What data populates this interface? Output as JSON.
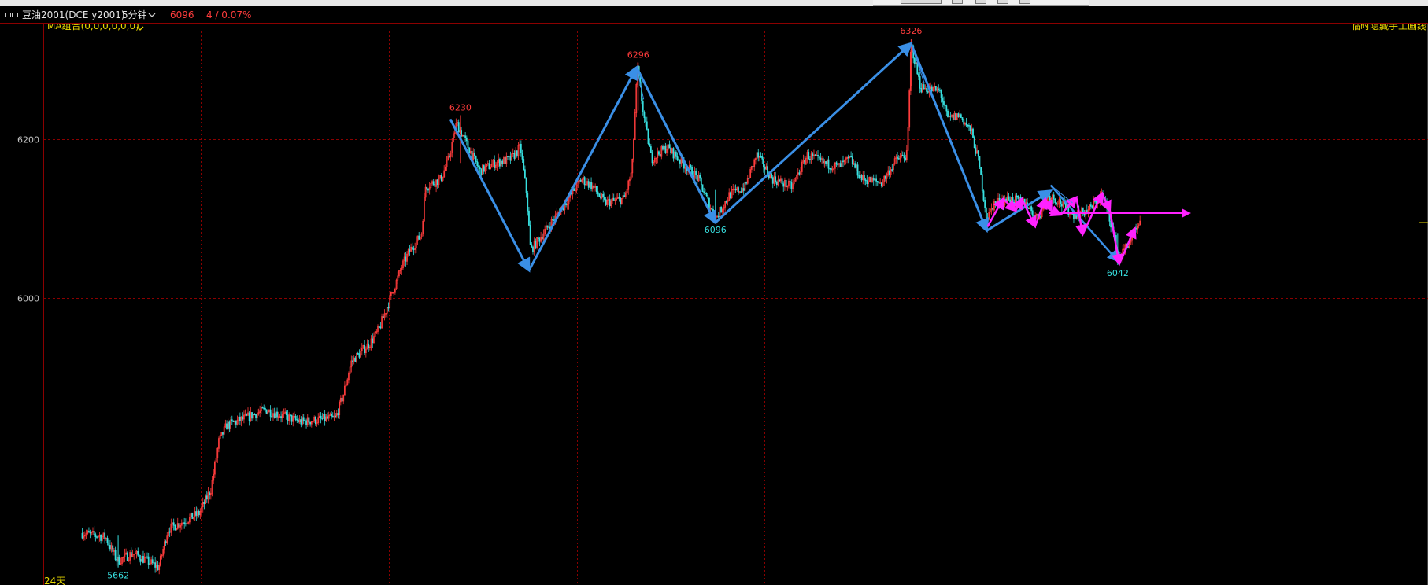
{
  "header": {
    "window_icon": "window-icon",
    "symbol": "豆油2001(DCE y2001)",
    "period": "5分钟",
    "period_dropdown_icon": "chevron-down-icon",
    "last_price": "6096",
    "change": "4 / 0.07%",
    "ma_label": "MA组合(0,0,0,0,0,0)",
    "hide_lines_label": "临时隐藏手工画线"
  },
  "colors": {
    "background": "#000000",
    "up": "#ff3c3c",
    "down": "#38e0e0",
    "grid": "#8b0000",
    "arrow_blue": "#3a8fe6",
    "arrow_magenta": "#ff22ff",
    "label_yellow": "#e8d800"
  },
  "chart_data": {
    "type": "candlestick",
    "period": "5分钟",
    "y_ticks": [
      6200,
      6000
    ],
    "ylim": [
      5640,
      6345
    ],
    "x_range": [
      0,
      1570
    ],
    "bottom_label": "24天",
    "price_labels": [
      {
        "x": 535,
        "value": 6230,
        "kind": "high"
      },
      {
        "x": 763,
        "value": 6296,
        "kind": "high"
      },
      {
        "x": 1113,
        "value": 6326,
        "kind": "high"
      },
      {
        "x": 862,
        "value": 6096,
        "kind": "low"
      },
      {
        "x": 1378,
        "value": 6042,
        "kind": "low"
      },
      {
        "x": 96,
        "value": 5662,
        "kind": "low"
      }
    ],
    "price_path": [
      [
        50,
        5705
      ],
      [
        80,
        5700
      ],
      [
        95,
        5670
      ],
      [
        115,
        5680
      ],
      [
        148,
        5662
      ],
      [
        160,
        5710
      ],
      [
        200,
        5730
      ],
      [
        215,
        5760
      ],
      [
        225,
        5820
      ],
      [
        235,
        5840
      ],
      [
        260,
        5850
      ],
      [
        285,
        5860
      ],
      [
        330,
        5845
      ],
      [
        375,
        5850
      ],
      [
        385,
        5880
      ],
      [
        395,
        5920
      ],
      [
        420,
        5945
      ],
      [
        430,
        5960
      ],
      [
        445,
        6000
      ],
      [
        460,
        6040
      ],
      [
        470,
        6060
      ],
      [
        485,
        6080
      ],
      [
        490,
        6140
      ],
      [
        510,
        6150
      ],
      [
        520,
        6175
      ],
      [
        530,
        6220
      ],
      [
        540,
        6200
      ],
      [
        560,
        6160
      ],
      [
        580,
        6170
      ],
      [
        600,
        6175
      ],
      [
        612,
        6190
      ],
      [
        620,
        6130
      ],
      [
        625,
        6060
      ],
      [
        640,
        6080
      ],
      [
        670,
        6120
      ],
      [
        690,
        6150
      ],
      [
        705,
        6140
      ],
      [
        720,
        6120
      ],
      [
        745,
        6125
      ],
      [
        755,
        6160
      ],
      [
        762,
        6290
      ],
      [
        770,
        6230
      ],
      [
        780,
        6175
      ],
      [
        800,
        6190
      ],
      [
        820,
        6170
      ],
      [
        840,
        6150
      ],
      [
        862,
        6100
      ],
      [
        880,
        6130
      ],
      [
        900,
        6140
      ],
      [
        915,
        6180
      ],
      [
        935,
        6150
      ],
      [
        960,
        6140
      ],
      [
        980,
        6180
      ],
      [
        1000,
        6170
      ],
      [
        1020,
        6165
      ],
      [
        1035,
        6175
      ],
      [
        1050,
        6150
      ],
      [
        1075,
        6145
      ],
      [
        1095,
        6175
      ],
      [
        1108,
        6180
      ],
      [
        1113,
        6320
      ],
      [
        1125,
        6265
      ],
      [
        1150,
        6260
      ],
      [
        1160,
        6225
      ],
      [
        1175,
        6230
      ],
      [
        1190,
        6210
      ],
      [
        1200,
        6170
      ],
      [
        1210,
        6100
      ],
      [
        1220,
        6120
      ],
      [
        1240,
        6125
      ],
      [
        1260,
        6120
      ],
      [
        1275,
        6100
      ],
      [
        1290,
        6130
      ],
      [
        1305,
        6120
      ],
      [
        1320,
        6105
      ],
      [
        1340,
        6110
      ],
      [
        1358,
        6130
      ],
      [
        1368,
        6100
      ],
      [
        1380,
        6050
      ],
      [
        1395,
        6075
      ],
      [
        1407,
        6093
      ]
    ],
    "annotations": {
      "blue_zigzag": [
        [
          522,
          6225
        ],
        [
          623,
          6035
        ],
        [
          761,
          6290
        ],
        [
          862,
          6095
        ],
        [
          1113,
          6320
        ],
        [
          1210,
          6085
        ],
        [
          1292,
          6135
        ]
      ],
      "blue_extra": [
        [
          1292,
          6142
        ],
        [
          1378,
          6047
        ]
      ],
      "magenta_zigzag": [
        [
          1211,
          6090
        ],
        [
          1231,
          6125
        ],
        [
          1247,
          6110
        ],
        [
          1255,
          6125
        ],
        [
          1272,
          6090
        ],
        [
          1285,
          6125
        ],
        [
          1293,
          6110
        ],
        [
          1305,
          6105
        ],
        [
          1325,
          6127
        ],
        [
          1333,
          6080
        ],
        [
          1358,
          6132
        ],
        [
          1368,
          6110
        ],
        [
          1380,
          6043
        ],
        [
          1400,
          6088
        ]
      ],
      "magenta_horizontal": {
        "from_x": 1290,
        "to_x": 1470,
        "value": 6107
      }
    }
  }
}
